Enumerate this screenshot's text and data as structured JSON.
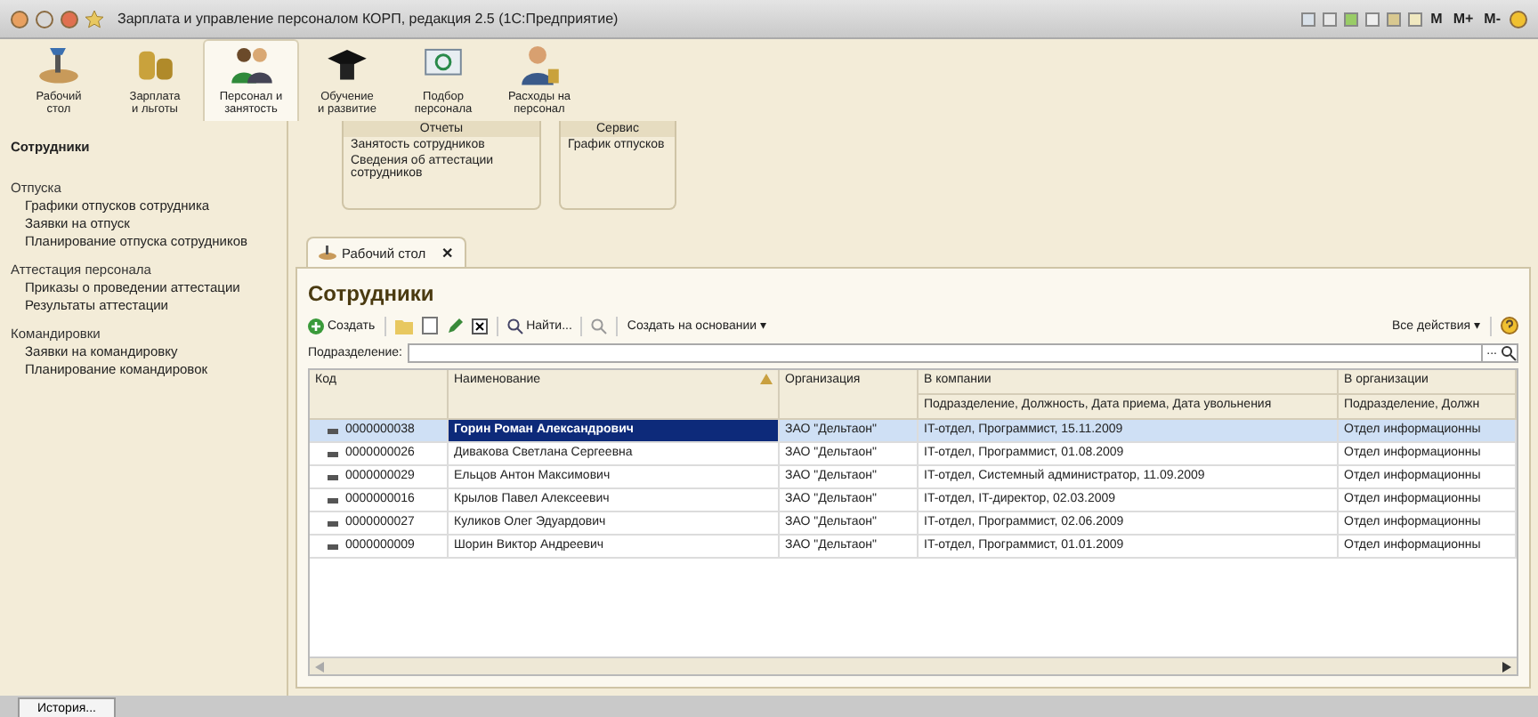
{
  "window": {
    "title": "Зарплата и управление персоналом КОРП, редакция 2.5  (1С:Предприятие)",
    "memory_buttons": [
      "M",
      "M+",
      "M-"
    ]
  },
  "sections": [
    {
      "label": "Рабочий\nстол",
      "kind": "desk",
      "selected": false
    },
    {
      "label": "Зарплата\nи льготы",
      "kind": "coins",
      "selected": false
    },
    {
      "label": "Персонал и\nзанятость",
      "kind": "people",
      "selected": true
    },
    {
      "label": "Обучение\nи развитие",
      "kind": "cap",
      "selected": false
    },
    {
      "label": "Подбор\nперсонала",
      "kind": "mail",
      "selected": false
    },
    {
      "label": "Расходы на\nперсонал",
      "kind": "person",
      "selected": false
    }
  ],
  "sidebar": {
    "title": "Сотрудники",
    "groups": [
      {
        "heading": "Отпуска",
        "items": [
          "Графики отпусков сотрудника",
          "Заявки на отпуск",
          "Планирование отпуска сотрудников"
        ]
      },
      {
        "heading": "Аттестация персонала",
        "items": [
          "Приказы о проведении аттестации",
          "Результаты аттестации"
        ]
      },
      {
        "heading": "Командировки",
        "items": [
          "Заявки на командировку",
          "Планирование командировок"
        ]
      }
    ]
  },
  "panels": [
    {
      "title": "Отчеты",
      "items": [
        "Занятость сотрудников",
        "Сведения об аттестации сотрудников"
      ]
    },
    {
      "title": "Сервис",
      "items": [
        "График отпусков"
      ]
    }
  ],
  "tab": {
    "label": "Рабочий стол",
    "close": "✕"
  },
  "form": {
    "title": "Сотрудники",
    "toolbar": {
      "create": "Создать",
      "find": "Найти...",
      "create_based": "Создать на основании",
      "create_based_caret": "▾",
      "all_actions": "Все действия",
      "all_actions_caret": "▾"
    },
    "filter": {
      "label": "Подразделение:",
      "choose": "..."
    },
    "table": {
      "columns": [
        {
          "label": "Код"
        },
        {
          "label": "Наименование",
          "sorted": true
        },
        {
          "label": "Организация"
        },
        {
          "label": "В компании",
          "sub": "Подразделение, Должность, Дата приема, Дата увольнения"
        },
        {
          "label": "В организации",
          "sub": "Подразделение, Должн"
        }
      ],
      "rows": [
        {
          "code": "0000000038",
          "name": "Горин Роман Александрович",
          "org": "ЗАО \"Дельтаон\"",
          "company": "IT-отдел, Программист, 15.11.2009",
          "org_dept": "Отдел информационны",
          "selected": true
        },
        {
          "code": "0000000026",
          "name": "Дивакова Светлана Сергеевна",
          "org": "ЗАО \"Дельтаон\"",
          "company": "IT-отдел, Программист, 01.08.2009",
          "org_dept": "Отдел информационны",
          "selected": false
        },
        {
          "code": "0000000029",
          "name": "Ельцов Антон Максимович",
          "org": "ЗАО \"Дельтаон\"",
          "company": "IT-отдел, Системный администратор, 11.09.2009",
          "org_dept": "Отдел информационны",
          "selected": false
        },
        {
          "code": "0000000016",
          "name": "Крылов Павел Алексеевич",
          "org": "ЗАО \"Дельтаон\"",
          "company": "IT-отдел, IT-директор, 02.03.2009",
          "org_dept": "Отдел информационны",
          "selected": false
        },
        {
          "code": "0000000027",
          "name": "Куликов Олег Эдуардович",
          "org": "ЗАО \"Дельтаон\"",
          "company": "IT-отдел, Программист, 02.06.2009",
          "org_dept": "Отдел информационны",
          "selected": false
        },
        {
          "code": "0000000009",
          "name": "Шорин Виктор Андреевич",
          "org": "ЗАО \"Дельтаон\"",
          "company": "IT-отдел, Программист, 01.01.2009",
          "org_dept": "Отдел информационны",
          "selected": false
        }
      ]
    }
  },
  "status_bar": {
    "history": "История..."
  }
}
